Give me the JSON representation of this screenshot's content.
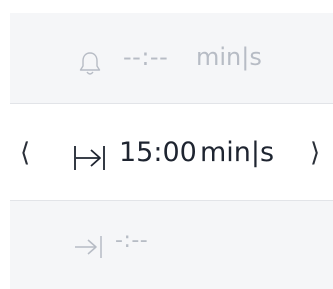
{
  "rows": {
    "top": {
      "icon": "bell-icon",
      "time": "--:--",
      "unit": "min|s"
    },
    "middle": {
      "prev_label": "⟨",
      "icon": "interval-icon",
      "time": "15:00",
      "unit": "min|s",
      "next_label": "⟩"
    },
    "bottom": {
      "icon": "skip-to-end-icon",
      "time": "-:--"
    }
  },
  "colors": {
    "muted_row_bg": "#f5f6f8",
    "muted_text": "#b7bcc5",
    "active_text": "#1e2430",
    "divider": "#e2e4e8"
  }
}
